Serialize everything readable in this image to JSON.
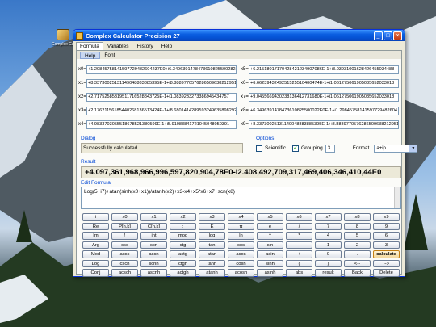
{
  "desktop": {
    "icon_label": "Complex Cal..."
  },
  "window": {
    "title": "Complex Calculator Precision 27",
    "buttons": [
      "_",
      "□",
      "×"
    ],
    "tabs": [
      {
        "label": "Formula",
        "active": true
      },
      {
        "label": "Variables",
        "active": false
      },
      {
        "label": "History",
        "active": false
      },
      {
        "label": "Help",
        "active": false
      }
    ],
    "menu": [
      "Help",
      "Font"
    ]
  },
  "variables": {
    "left": [
      {
        "label": "x0=",
        "value": "+1.29845758141597729482604237E0+i6.34963914784736108255002822"
      },
      {
        "label": "x1=",
        "value": "+8.33730025131149048883885395E-1+i8.8889770576286509638212951"
      },
      {
        "label": "x2=",
        "value": "+2.71752585319511716528843725E-1+i1.0839233273386945434757"
      },
      {
        "label": "x3=",
        "value": "+2.17621156185440268136513424E-1+i8.6801414289593249635898292"
      },
      {
        "label": "x4=",
        "value": "+4.9833703055518678521380599E-1+i5.91083841721045048050391"
      }
    ],
    "right": [
      {
        "label": "x5=",
        "value": "+6.21518017170428421234907086E-1+i3.03931001628426455034488"
      },
      {
        "label": "x6=",
        "value": "+6.6623943249251525510400474E-1+i1.061275061905035652033018"
      },
      {
        "label": "x7=",
        "value": "+9.0455669430238136412731680E-1+i1.061275061905035652033018"
      },
      {
        "label": "x8=",
        "value": "+6.3496391478473610825500022E0E-1+i1.29845758141597729482604"
      },
      {
        "label": "x9=",
        "value": "+8.33730025131149048883885395E-1+i8.8889770576286509638212951"
      }
    ]
  },
  "dialog": {
    "title": "Dialog",
    "message": "Successfully calculated."
  },
  "options": {
    "title": "Options",
    "scientific": {
      "label": "Scientific",
      "checked": false
    },
    "grouping": {
      "label": "Grouping",
      "checked": true,
      "value": "3"
    },
    "format": {
      "label": "Format",
      "value": "a+ip"
    }
  },
  "result": {
    "title": "Result",
    "value": "+4.097,361,968,966,996,597,820,904,78E0-i2.408,492,709,317,469,406,346,410,44E0"
  },
  "formula": {
    "title": "Edit Formula",
    "value": "Log(5+i7)+atan(sinh(x0+x1))/atanh(x2)+x3-x4+x5*x6+x7+scn(x8)"
  },
  "keypad": [
    [
      "i",
      "x0",
      "x1",
      "x2",
      "x3",
      "x4",
      "x5",
      "x6",
      "x7",
      "x8",
      "x9"
    ],
    [
      "Re",
      "P[n,k]",
      "C[n,k]",
      ";",
      "E",
      "π",
      "e",
      "/",
      "7",
      "8",
      "9"
    ],
    [
      "Im",
      "!",
      "int",
      "mod",
      "log",
      "ln",
      "^",
      "*",
      "4",
      "5",
      "6"
    ],
    [
      "Arg",
      "csc",
      "scn",
      "ctg",
      "tan",
      "cos",
      "sin",
      "-",
      "1",
      "2",
      "3"
    ],
    [
      "Mod",
      "acsc",
      "ascn",
      "actg",
      "atan",
      "acos",
      "asin",
      "+",
      "0",
      ".",
      "calculate"
    ],
    [
      "Log",
      "csch",
      "scnh",
      "ctgh",
      "tanh",
      "cosh",
      "sinh",
      "(",
      ")",
      "<--",
      "-->"
    ],
    [
      "Conj",
      "acsch",
      "ascnh",
      "actgh",
      "atanh",
      "acosh",
      "asinh",
      "abs",
      "result",
      "Back",
      "Delete"
    ]
  ]
}
